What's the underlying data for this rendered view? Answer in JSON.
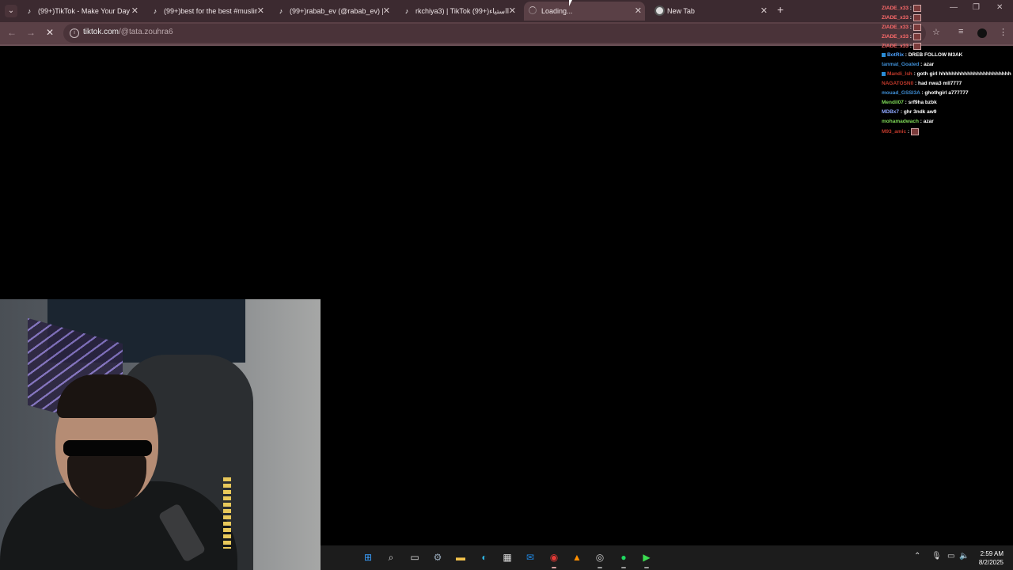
{
  "browser": {
    "tabs": [
      {
        "title": "(99+)TikTok - Make Your Day",
        "icon": "tiktok-icon",
        "active": false
      },
      {
        "title": "(99+)best for the best #muslim",
        "icon": "tiktok-icon",
        "active": false
      },
      {
        "title": "(99+)rabab_ev (@rabab_ev) | Ti",
        "icon": "tiktok-icon",
        "active": false
      },
      {
        "title": "rkchiya3) | TikTok ااااستیاء(+99)",
        "icon": "tiktok-icon",
        "active": false
      },
      {
        "title": "Loading...",
        "icon": "loading-spinner",
        "active": true
      },
      {
        "title": "New Tab",
        "icon": "chrome-icon",
        "active": false
      }
    ],
    "new_tab_symbol": "+",
    "close_symbol": "✕",
    "address": {
      "domain": "tiktok.com",
      "path": "/@tata.zouhra6"
    },
    "colors": {
      "tabstrip": "#3c2a30",
      "toolbar": "#5a4046"
    }
  },
  "chat": [
    {
      "user": "ZIADE_x33",
      "color": "#ff6b6b",
      "message": "",
      "emote": true
    },
    {
      "user": "ZIADE_x33",
      "color": "#ff6b6b",
      "message": "",
      "emote": true
    },
    {
      "user": "ZIADE_x33",
      "color": "#ff6b6b",
      "message": "",
      "emote": true
    },
    {
      "user": "ZIADE_x33",
      "color": "#ff6b6b",
      "message": "",
      "emote": true
    },
    {
      "user": "ZIADE_x33",
      "color": "#ff6b6b",
      "message": "",
      "emote": true
    },
    {
      "user": "BotRix",
      "color": "#4fa3ff",
      "message": "DREB FOLLOW M3AK",
      "emote": false,
      "badge": true
    },
    {
      "user": "tanmat_Goated",
      "color": "#3f8fd6",
      "message": "azar",
      "emote": false
    },
    {
      "user": "Mandi_lsh",
      "color": "#c0392b",
      "message": "goth girl hhhhhhhhhhhhhhhhhhhhhhh",
      "emote": false,
      "badge": true
    },
    {
      "user": "NAGATOSN0",
      "color": "#c0392b",
      "message": "had nwa3 mll7777",
      "emote": false
    },
    {
      "user": "mouad_GSSI3A",
      "color": "#3f8fd6",
      "message": "ghothgirl a777777",
      "emote": false
    },
    {
      "user": "Mendil07",
      "color": "#7ed957",
      "message": "srf9ha bzbk",
      "emote": false
    },
    {
      "user": "MDBx7",
      "color": "#8fa8ff",
      "message": "ghr 3ndk aw9",
      "emote": false
    },
    {
      "user": "mohamadwach",
      "color": "#7ed957",
      "message": "azar",
      "emote": false
    },
    {
      "user": "M93_amic",
      "color": "#c0392b",
      "message": "",
      "emote": true
    }
  ],
  "taskbar": {
    "apps": [
      "windows-start-icon",
      "search-icon",
      "task-view-icon",
      "settings-icon",
      "file-explorer-icon",
      "edge-icon",
      "store-icon",
      "outlook-icon",
      "chrome-icon",
      "vlc-icon",
      "obs-icon",
      "spotify-icon",
      "app-arrow-icon"
    ],
    "time": "2:59 AM",
    "date": "8/2/2025"
  }
}
